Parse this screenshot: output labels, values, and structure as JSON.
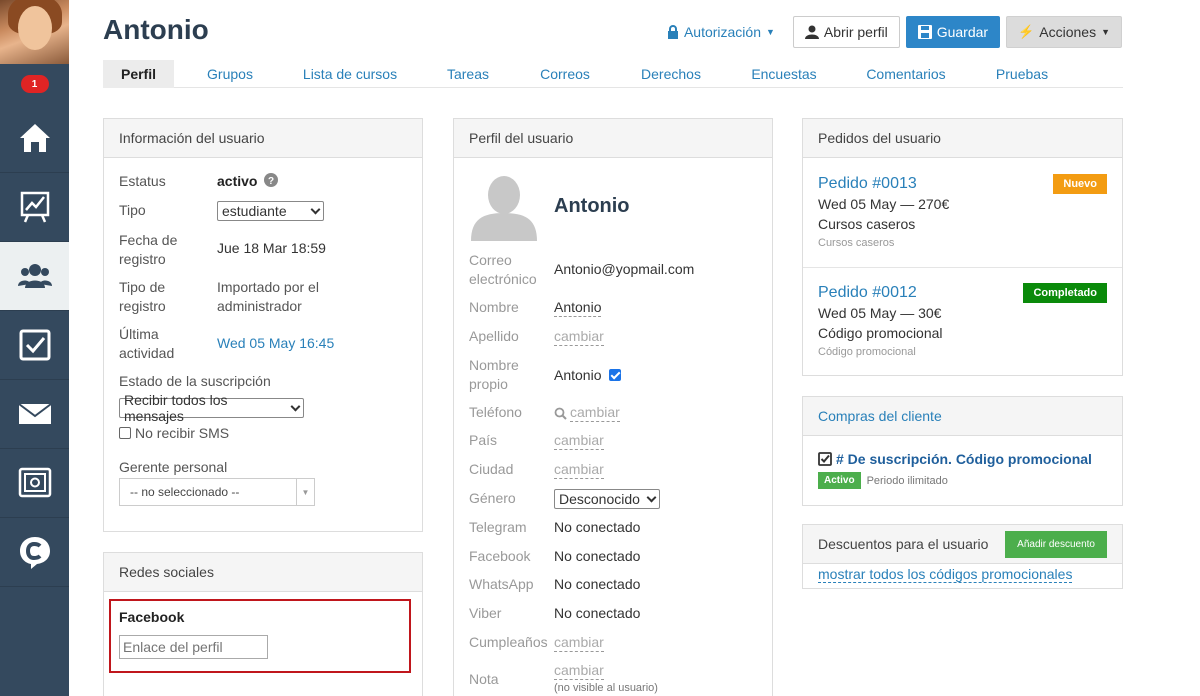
{
  "sidebar": {
    "notification_count": "1",
    "items": [
      {
        "icon": "home-icon"
      },
      {
        "icon": "chart-icon"
      },
      {
        "icon": "users-icon",
        "active": true
      },
      {
        "icon": "checkbox-icon"
      },
      {
        "icon": "mail-icon"
      },
      {
        "icon": "safe-icon"
      },
      {
        "icon": "chat-logo-icon"
      }
    ]
  },
  "header": {
    "title": "Antonio",
    "authorization_label": "Autorización",
    "open_profile_label": "Abrir perfil",
    "save_label": "Guardar",
    "actions_label": "Acciones"
  },
  "tabs": [
    "Perfil",
    "Grupos",
    "Lista de cursos",
    "Tareas",
    "Correos",
    "Derechos",
    "Encuestas",
    "Comentarios",
    "Pruebas"
  ],
  "user_info": {
    "heading": "Información del usuario",
    "status_label": "Estatus",
    "status_value": "activo",
    "type_label": "Tipo",
    "type_value": "estudiante",
    "reg_date_label_1": "Fecha de",
    "reg_date_label_2": "registro",
    "reg_date_value": "Jue 18 Mar 18:59",
    "reg_type_label_1": "Tipo de",
    "reg_type_label_2": "registro",
    "reg_type_value_1": "Importado por el",
    "reg_type_value_2": "administrador",
    "last_activity_label_1": "Última",
    "last_activity_label_2": "actividad",
    "last_activity_value": "Wed 05 May 16:45",
    "subscription_label": "Estado de la suscripción",
    "subscription_value": "Recibir todos los mensajes",
    "no_sms_label": "No recibir SMS",
    "manager_label": "Gerente personal",
    "manager_value": "-- no seleccionado --"
  },
  "social": {
    "heading": "Redes sociales",
    "network_label": "Facebook",
    "input_placeholder": "Enlace del perfil"
  },
  "profile": {
    "heading": "Perfil del usuario",
    "name": "Antonio",
    "email_label_1": "Correo",
    "email_label_2": "electrónico",
    "email_value": "Antonio@yopmail.com",
    "first_name_label": "Nombre",
    "first_name_value": "Antonio",
    "last_name_label": "Apellido",
    "change_label": "cambiar",
    "own_name_label_1": "Nombre",
    "own_name_label_2": "propio",
    "own_name_value": "Antonio",
    "phone_label": "Teléfono",
    "country_label": "País",
    "city_label": "Ciudad",
    "gender_label": "Género",
    "gender_value": "Desconocido",
    "telegram_label": "Telegram",
    "facebook_label": "Facebook",
    "whatsapp_label": "WhatsApp",
    "viber_label": "Viber",
    "not_connected": "No conectado",
    "birthday_label": "Cumpleaños",
    "note_label": "Nota",
    "note_hint": "(no visible al usuario)"
  },
  "orders": {
    "heading": "Pedidos del usuario",
    "items": [
      {
        "title": "Pedido #0013",
        "line": "Wed 05 May — 270€",
        "product": "Cursos caseros",
        "sub": "Cursos caseros",
        "status": "Nuevo",
        "status_color": "#f39c12"
      },
      {
        "title": "Pedido #0012",
        "line": "Wed 05 May — 30€",
        "product": "Código promocional",
        "sub": "Código promocional",
        "status": "Completado",
        "status_color": "#0a8a0a"
      }
    ]
  },
  "purchases": {
    "heading": "Compras del cliente",
    "item_title": "# De suscripción. Código promocional",
    "item_status": "Activo",
    "item_period": "Periodo ilimitado"
  },
  "discounts": {
    "heading": "Descuentos para el usuario",
    "add_label": "Añadir descuento",
    "show_all_label": "mostrar todos los códigos promocionales"
  }
}
